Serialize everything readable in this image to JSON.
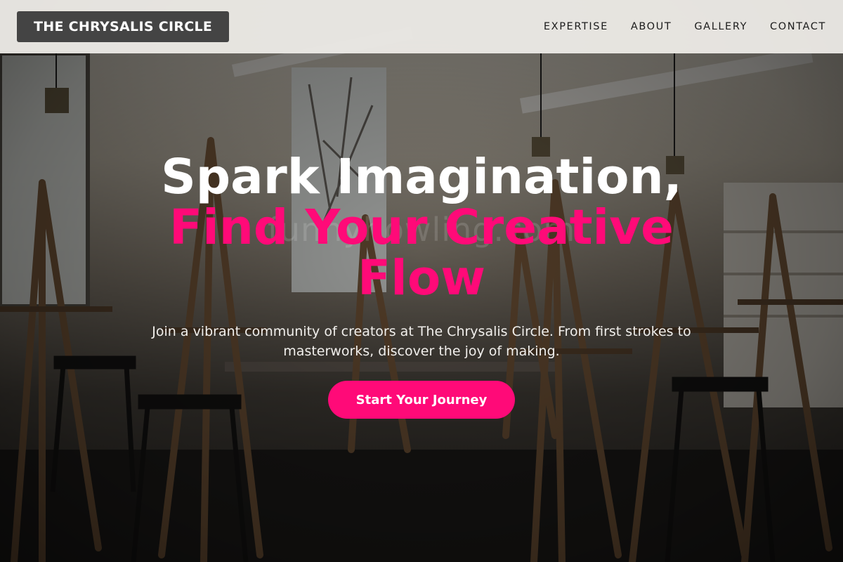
{
  "header": {
    "logo": "THE CHRYSALIS CIRCLE",
    "nav": [
      {
        "label": "EXPERTISE"
      },
      {
        "label": "ABOUT"
      },
      {
        "label": "GALLERY"
      },
      {
        "label": "CONTACT"
      }
    ]
  },
  "hero": {
    "headline_line1": "Spark Imagination,",
    "headline_line2": "Find Your Creative Flow",
    "subtitle": "Join a vibrant community of creators at The Chrysalis Circle. From first strokes to masterworks, discover the joy of making.",
    "cta_label": "Start Your Journey",
    "watermark": "funnyhowling.com"
  },
  "colors": {
    "accent": "#ff0a78",
    "logo_bg": "#444444",
    "header_bg": "#f0eeea"
  }
}
